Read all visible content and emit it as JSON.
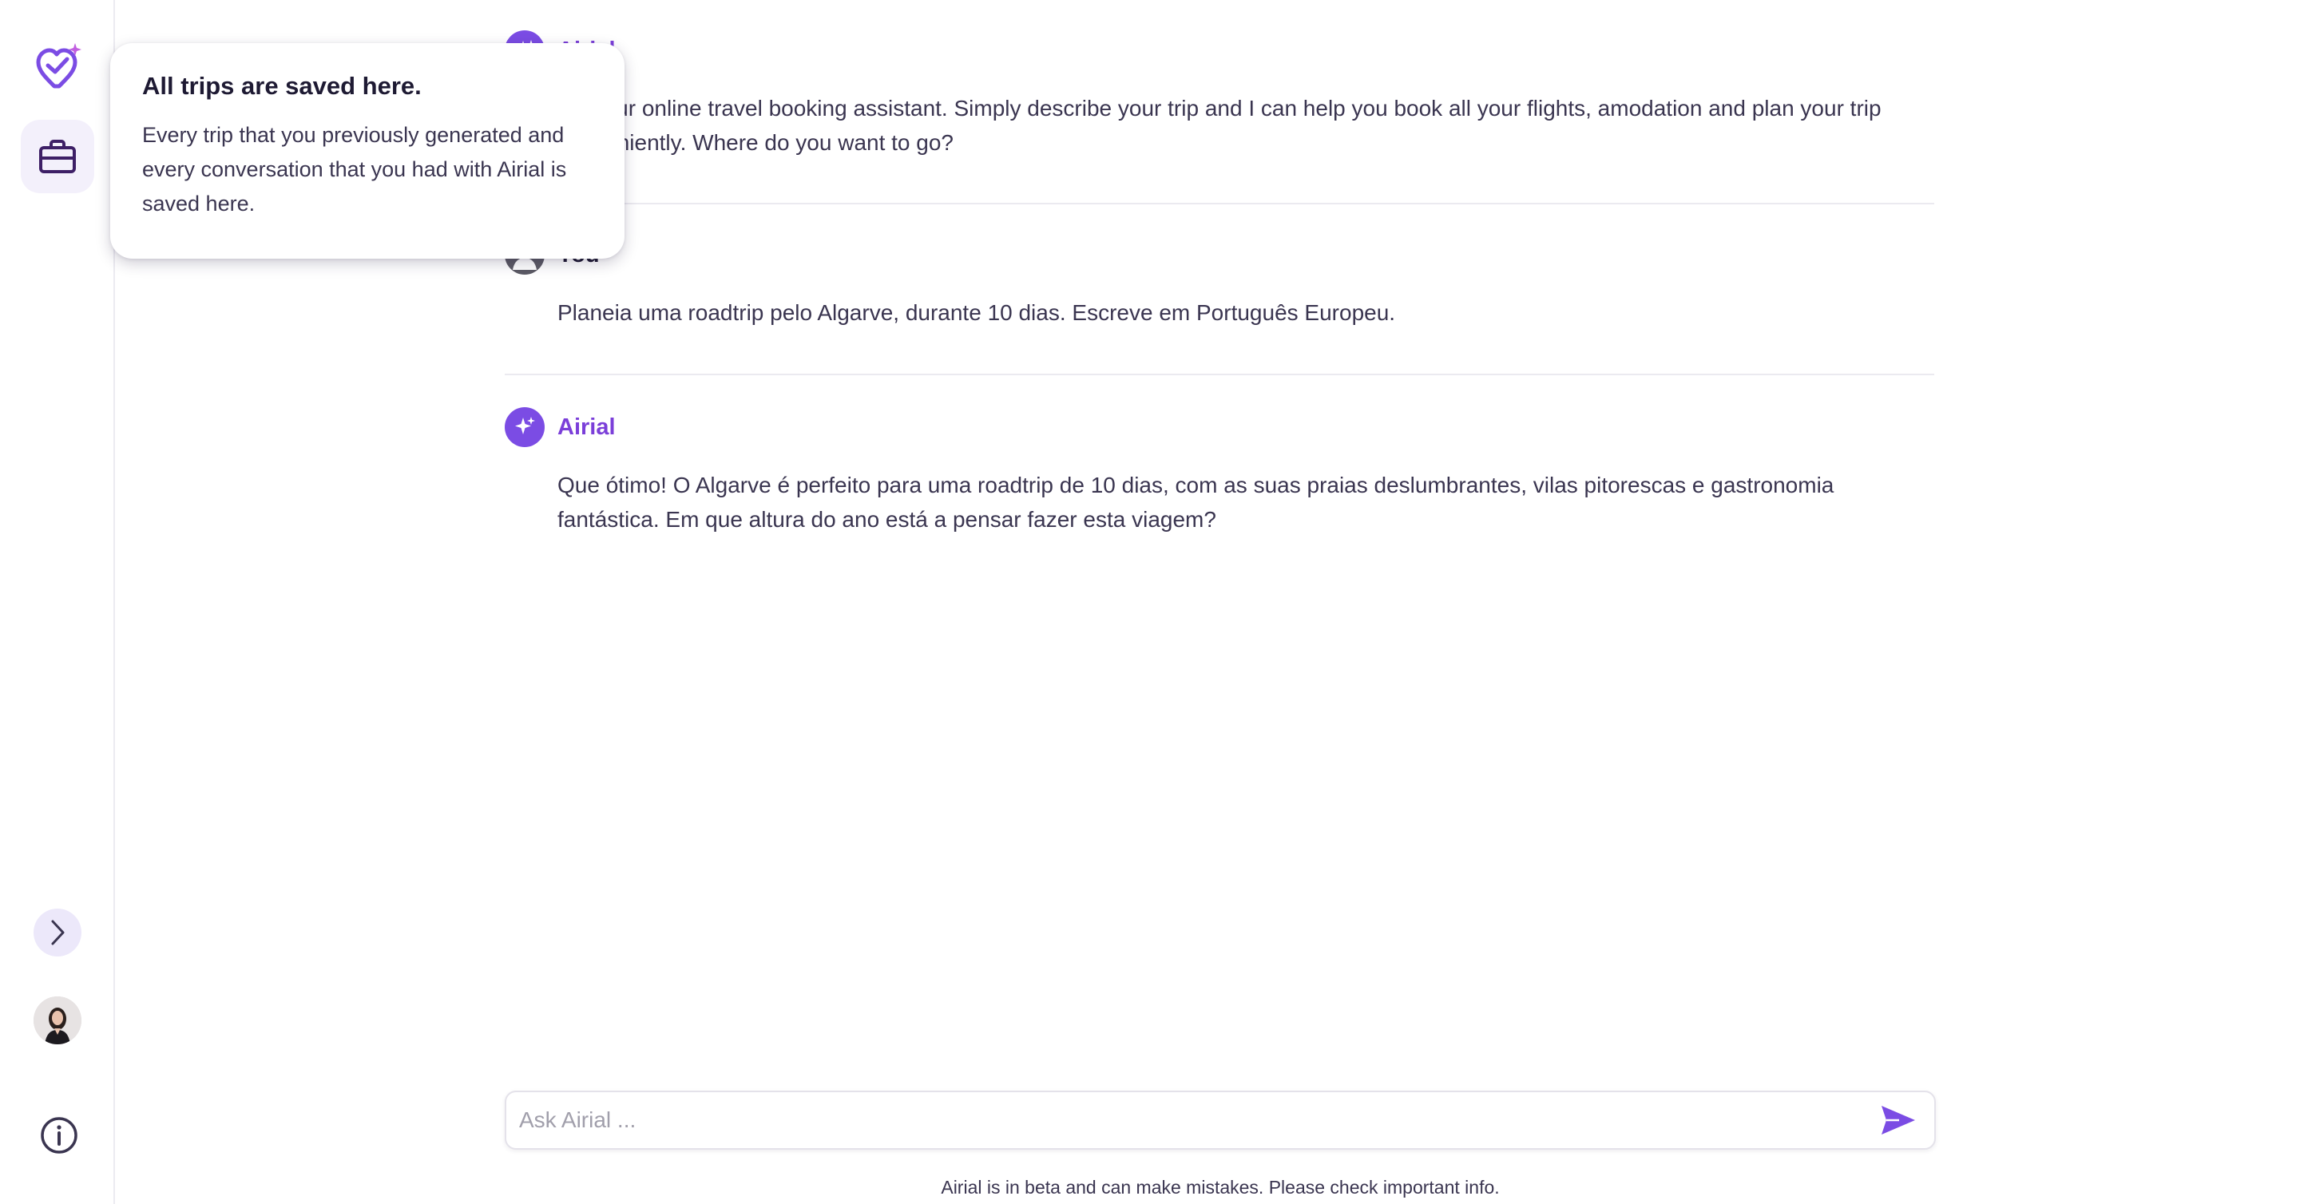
{
  "sidebar": {
    "logo_icon": "heart-pin-sparkle-icon",
    "trips_icon": "briefcase-icon",
    "expand_icon": "chevron-right-icon",
    "avatar_icon": "user-avatar",
    "info_icon": "info-icon"
  },
  "tooltip": {
    "title": "All trips are saved here.",
    "body": "Every trip that you previously generated and every conversation that you had with Airial is saved here."
  },
  "messages": [
    {
      "sender": "Airial",
      "role": "assistant",
      "text": "ial, your online travel booking assistant. Simply describe your trip and I can help you book all your flights, amodation and plan your trip conveniently. Where do you want to go?"
    },
    {
      "sender": "You",
      "role": "user",
      "text": "Planeia uma roadtrip pelo Algarve, durante 10 dias. Escreve em Português Europeu."
    },
    {
      "sender": "Airial",
      "role": "assistant",
      "text": "Que ótimo! O Algarve é perfeito para uma roadtrip de 10 dias, com as suas praias deslumbrantes, vilas pitorescas e gastronomia fantástica. Em que altura do ano está a pensar fazer esta viagem?"
    }
  ],
  "input": {
    "placeholder": "Ask Airial ...",
    "value": "",
    "send_icon": "send-icon"
  },
  "footer": {
    "note": "Airial is in beta and can make mistakes. Please check important info."
  },
  "colors": {
    "accent": "#7b4ce4",
    "sender_ai": "#7b3fd9",
    "text": "#3a3550"
  }
}
